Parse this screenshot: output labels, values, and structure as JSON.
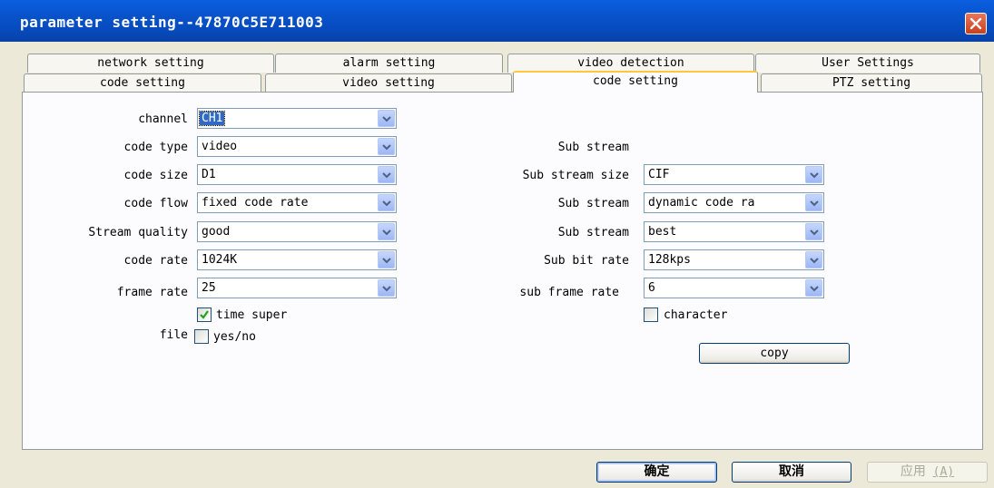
{
  "window": {
    "title": "parameter setting--47870C5E711003"
  },
  "tabs_row1": [
    {
      "label": "network setting"
    },
    {
      "label": "alarm setting"
    },
    {
      "label": "video detection"
    },
    {
      "label": "User Settings"
    }
  ],
  "tabs_row2": [
    {
      "label": "code setting"
    },
    {
      "label": "video setting"
    },
    {
      "label": "code setting",
      "active": true
    },
    {
      "label": "PTZ setting"
    }
  ],
  "left": {
    "channel": {
      "label": "channel",
      "value": "CH1"
    },
    "code_type": {
      "label": "code type",
      "value": "video"
    },
    "code_size": {
      "label": "code size",
      "value": "D1"
    },
    "code_flow": {
      "label": "code flow",
      "value": "fixed code rate"
    },
    "stream_quality": {
      "label": "Stream quality",
      "value": "good"
    },
    "code_rate": {
      "label": "code rate",
      "value": "1024K"
    },
    "frame_rate": {
      "label": "frame rate",
      "value": "25"
    },
    "time_super": {
      "label": "time super",
      "checked": true
    },
    "file": {
      "label": "file",
      "checkbox_label": "yes/no",
      "checked": false
    }
  },
  "right": {
    "sub_stream_heading": "Sub stream",
    "sub_stream_size": {
      "label": "Sub stream size",
      "value": "CIF"
    },
    "sub_stream_flow": {
      "label": "Sub stream",
      "value": "dynamic code ra"
    },
    "sub_stream_quality": {
      "label": "Sub stream",
      "value": "best"
    },
    "sub_bit_rate": {
      "label": "Sub bit rate",
      "value": "128kps"
    },
    "sub_frame_rate": {
      "label": "sub frame rate",
      "value": "6"
    },
    "character": {
      "label": "character",
      "checked": false
    },
    "copy_label": "copy"
  },
  "footer": {
    "ok_label": "确定",
    "cancel_label": "取消",
    "apply_label": "应用",
    "apply_shortcut": "(A)"
  },
  "colors": {
    "titlebar": "#0852C9",
    "dialog_bg": "#ECE9D8",
    "active_tab_accent": "#FFC83C",
    "selection": "#316AC5",
    "close_button": "#D7522F"
  }
}
